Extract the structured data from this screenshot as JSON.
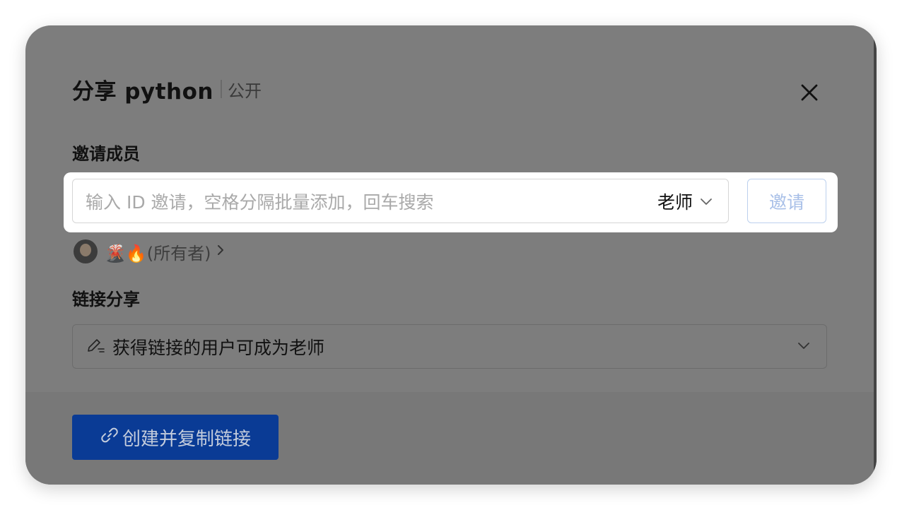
{
  "dialog": {
    "title": "分享 python",
    "visibility": "公开"
  },
  "invite": {
    "section_label": "邀请成员",
    "placeholder": "输入 ID 邀请，空格分隔批量添加，回车搜索",
    "role": "老师",
    "button_label": "邀请"
  },
  "owner": {
    "label": "🌋🔥(所有者)"
  },
  "link_share": {
    "section_label": "链接分享",
    "permission": "获得链接的用户可成为老师"
  },
  "footer": {
    "create_label": "创建并复制链接"
  },
  "icons": {
    "close": "close-icon",
    "role_chevron": "chevron-down-icon",
    "owner_chevron": "chevron-right-icon",
    "link_edit": "edit-pen-icon",
    "link_chevron": "chevron-down-icon",
    "create": "link-icon"
  },
  "colors": {
    "primary_button": "#0a3b95",
    "invite_button_border": "#bcd0ee"
  }
}
